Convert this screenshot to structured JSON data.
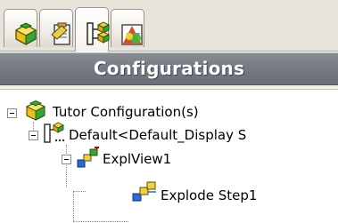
{
  "tabs": [
    {
      "icon": "feature-manager-icon",
      "active": false
    },
    {
      "icon": "property-manager-icon",
      "active": false
    },
    {
      "icon": "configuration-manager-icon",
      "active": true
    },
    {
      "icon": "display-manager-icon",
      "active": false
    }
  ],
  "header": {
    "title": "Configurations"
  },
  "tree": {
    "root": {
      "label": "Tutor Configuration(s)",
      "icon": "part-configurations-icon"
    },
    "config": {
      "label": "Default<Default_Display S",
      "icon": "configuration-icon"
    },
    "view": {
      "label": "ExplView1",
      "icon": "exploded-view-icon"
    },
    "step": {
      "label": "Explode Step1",
      "icon": "explode-step-icon"
    }
  }
}
